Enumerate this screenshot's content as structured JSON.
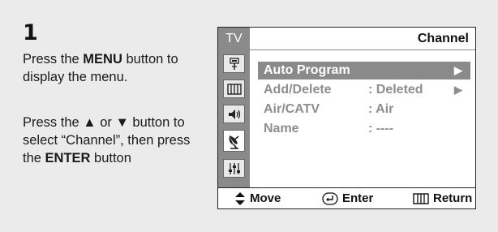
{
  "step": {
    "number": "1"
  },
  "instructions": {
    "p1_prefix": "Press the ",
    "p1_bold": "MENU",
    "p1_suffix": " button to display the menu.",
    "p2_prefix": "Press the ",
    "p2_up_glyph": "▲",
    "p2_or": " or ",
    "p2_down_glyph": "▼",
    "p2_mid": " button to select “Channel”, then press the ",
    "p2_bold": "ENTER",
    "p2_suffix": " button"
  },
  "osd": {
    "sidebar_label": "TV",
    "title": "Channel",
    "sidebar_icons": [
      "antenna-input-icon",
      "picture-icon",
      "sound-icon",
      "channel-dish-icon",
      "setup-icon"
    ],
    "menu": [
      {
        "label": "Auto Program",
        "value": "",
        "arrow": "▶",
        "selected": true
      },
      {
        "label": "Add/Delete",
        "value": ": Deleted",
        "arrow": "▶",
        "selected": false
      },
      {
        "label": "Air/CATV",
        "value": ": Air",
        "arrow": "",
        "selected": false
      },
      {
        "label": "Name",
        "value": ": ----",
        "arrow": "",
        "selected": false
      }
    ],
    "bottom": {
      "move_label": "Move",
      "enter_label": "Enter",
      "return_label": "Return"
    }
  },
  "colors": {
    "background": "#ebebeb",
    "sidebar": "#8a8a8a",
    "highlight": "#8a8a8a",
    "inactive_text": "#8e8e8e"
  }
}
